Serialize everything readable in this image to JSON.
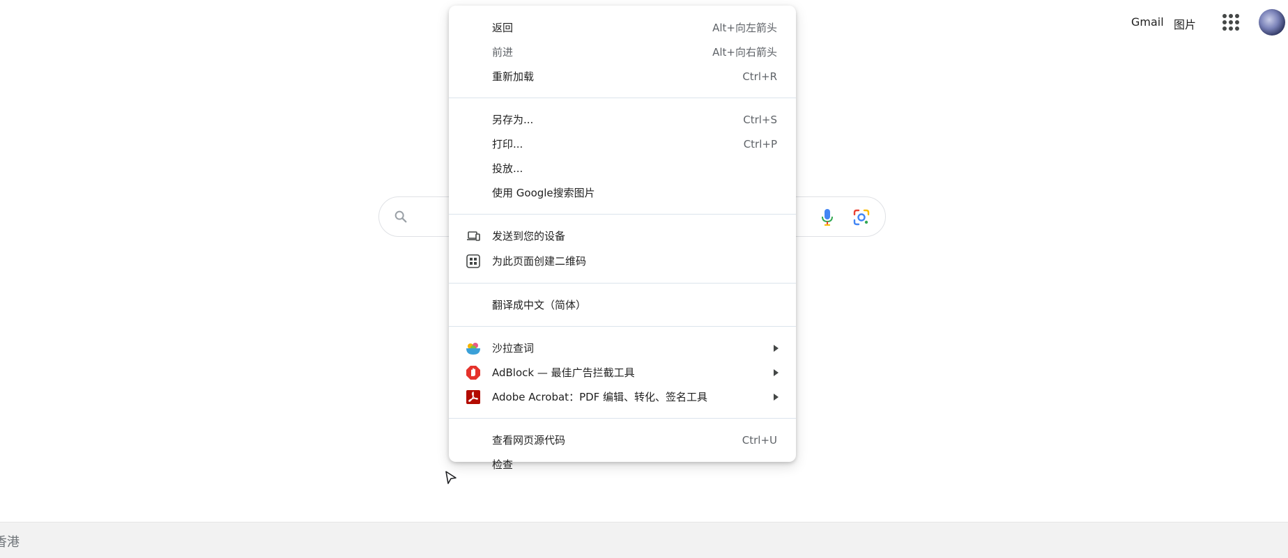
{
  "topbar": {
    "gmail": "Gmail",
    "images": "图片"
  },
  "search": {
    "value": ""
  },
  "footer": {
    "region": "香港"
  },
  "context_menu": {
    "group1": [
      {
        "label": "返回",
        "shortcut": "Alt+向左箭头"
      },
      {
        "label": "前进",
        "shortcut": "Alt+向右箭头"
      },
      {
        "label": "重新加载",
        "shortcut": "Ctrl+R"
      }
    ],
    "group2": [
      {
        "label": "另存为...",
        "shortcut": "Ctrl+S"
      },
      {
        "label": "打印...",
        "shortcut": "Ctrl+P"
      },
      {
        "label": "投放..."
      },
      {
        "label": "使用 Google搜索图片"
      }
    ],
    "group3": [
      {
        "label": "发送到您的设备",
        "icon": "devices-icon"
      },
      {
        "label": "为此页面创建二维码",
        "icon": "qr-code-icon"
      }
    ],
    "group4": [
      {
        "label": "翻译成中文（简体）"
      }
    ],
    "group5": [
      {
        "label": "沙拉查词",
        "icon": "saladict-icon"
      },
      {
        "label": "AdBlock — 最佳广告拦截工具",
        "icon": "adblock-icon"
      },
      {
        "label": "Adobe Acrobat：PDF 编辑、转化、签名工具",
        "icon": "acrobat-icon"
      }
    ],
    "group6": [
      {
        "label": "查看网页源代码",
        "shortcut": "Ctrl+U"
      },
      {
        "label": "检查"
      }
    ]
  },
  "colors": {
    "adblock_red": "#e5322b",
    "acrobat_red": "#b30b00",
    "mic_blue": "#4285f4",
    "mic_red": "#ea4335"
  }
}
